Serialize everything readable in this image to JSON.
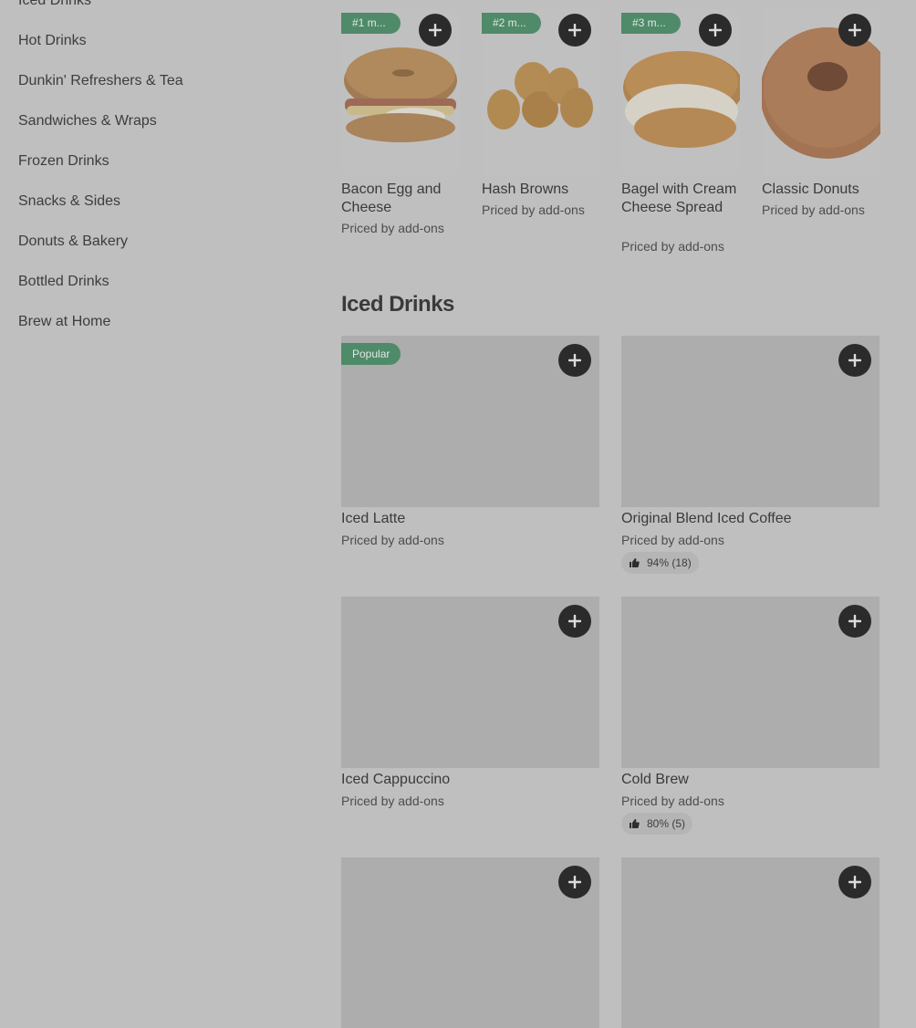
{
  "sidebar": {
    "categories": [
      "Iced Drinks",
      "Hot Drinks",
      "Dunkin' Refreshers & Tea",
      "Sandwiches & Wraps",
      "Frozen Drinks",
      "Snacks & Sides",
      "Donuts & Bakery",
      "Bottled Drinks",
      "Brew at Home"
    ]
  },
  "popular_items": [
    {
      "badge": "#1 m...",
      "title": "Bacon Egg and Cheese",
      "price": "Priced by add-ons"
    },
    {
      "badge": "#2 m...",
      "title": "Hash Browns",
      "price": "Priced by add-ons"
    },
    {
      "badge": "#3 m...",
      "title": "Bagel with Cream Cheese Spread",
      "price": "Priced by add-ons"
    },
    {
      "badge": "",
      "title": "Classic Donuts",
      "price": "Priced by add-ons"
    }
  ],
  "iced_section": {
    "title": "Iced Drinks",
    "items": [
      {
        "badge": "Popular",
        "title": "Iced Latte",
        "price": "Priced by add-ons",
        "rating": ""
      },
      {
        "badge": "",
        "title": "Original Blend Iced Coffee",
        "price": "Priced by add-ons",
        "rating": "94% (18)"
      },
      {
        "badge": "",
        "title": "Iced Cappuccino",
        "price": "Priced by add-ons",
        "rating": ""
      },
      {
        "badge": "",
        "title": "Cold Brew",
        "price": "Priced by add-ons",
        "rating": "80% (5)"
      }
    ]
  },
  "icons": {
    "add": "plus-icon",
    "rating": "thumbs-up-icon"
  },
  "colors": {
    "badge_green": "#4f8a69",
    "add_button": "#2b2b2b",
    "overlay_bg": "#bfbfbf"
  }
}
